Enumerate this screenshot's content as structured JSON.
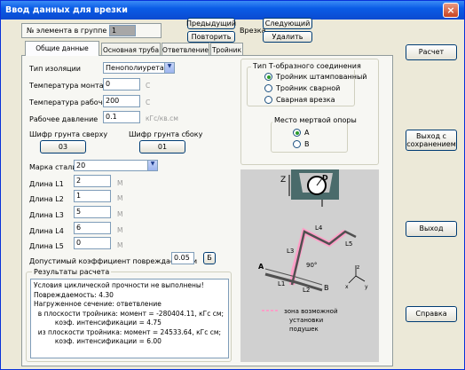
{
  "window": {
    "title": "Ввод данных для врезки",
    "close": "×"
  },
  "header": {
    "element_label": "№ элемента в группе",
    "element_value": "1",
    "prev": "Предыдущий",
    "next": "Следующий",
    "repeat": "Повторить",
    "tie_label": "Врезка",
    "delete": "Удалить"
  },
  "tabs": [
    "Общие данные",
    "Основная труба",
    "Ответвление",
    "Тройник"
  ],
  "form": {
    "insulation_label": "Тип изоляции",
    "insulation_value": "Пенополиуретан",
    "mount_temp_label": "Температура монтажа",
    "mount_temp_value": "0",
    "mount_temp_unit": "С",
    "work_temp_label": "Температура рабочая",
    "work_temp_value": "200",
    "work_temp_unit": "С",
    "pressure_label": "Рабочее давление",
    "pressure_value": "0.1",
    "pressure_unit": "кГс/кв.см",
    "soil_top_label": "Шифр грунта сверху",
    "soil_top_btn": "03",
    "soil_side_label": "Шифр грунта сбоку",
    "soil_side_btn": "01",
    "steel_label": "Марка стали",
    "steel_value": "20",
    "lengths": [
      {
        "label": "Длина L1",
        "value": "2",
        "unit": "М"
      },
      {
        "label": "Длина L2",
        "value": "1",
        "unit": "М"
      },
      {
        "label": "Длина L3",
        "value": "5",
        "unit": "М"
      },
      {
        "label": "Длина L4",
        "value": "6",
        "unit": "М"
      },
      {
        "label": "Длина L5",
        "value": "0",
        "unit": "М"
      }
    ],
    "damage_label": "Допустимый коэффициент повреждаемости",
    "damage_value": "0.05",
    "damage_btn": "Б"
  },
  "results": {
    "title": "Результаты расчета",
    "lines": [
      "Условия циклической прочности не выполнены!",
      "Повреждаемость: 4.30",
      "Нагруженное сечение: ответвление",
      "  в плоскости тройника: момент = -280404.11, кГс см;",
      "          коэф. интенсификации = 4.75",
      "  из плоскости тройника: момент = 24533.64, кГс см;",
      "          коэф. интенсификации = 6.00"
    ]
  },
  "tee_type": {
    "title": "Тип Т-образного соединения",
    "options": [
      "Тройник штампованный",
      "Тройник сварной",
      "Сварная врезка"
    ],
    "selected": 0
  },
  "anchor": {
    "title": "Место мертвой опоры",
    "options": [
      "А",
      "В"
    ],
    "selected": 0
  },
  "diagram": {
    "labels": {
      "z": "Z",
      "d": "D",
      "l1": "L1",
      "l2": "L2",
      "l3": "L3",
      "l4": "L4",
      "l5": "L5",
      "a": "A",
      "b": "B",
      "angle": "90°",
      "x": "x",
      "y": "y",
      "z_axis": "z"
    },
    "legend": [
      "зона возможной",
      "установки",
      "подушек"
    ]
  },
  "side_buttons": {
    "calc": "Расчет",
    "exit_save": "Выход с сохранением",
    "exit": "Выход",
    "help": "Справка"
  }
}
